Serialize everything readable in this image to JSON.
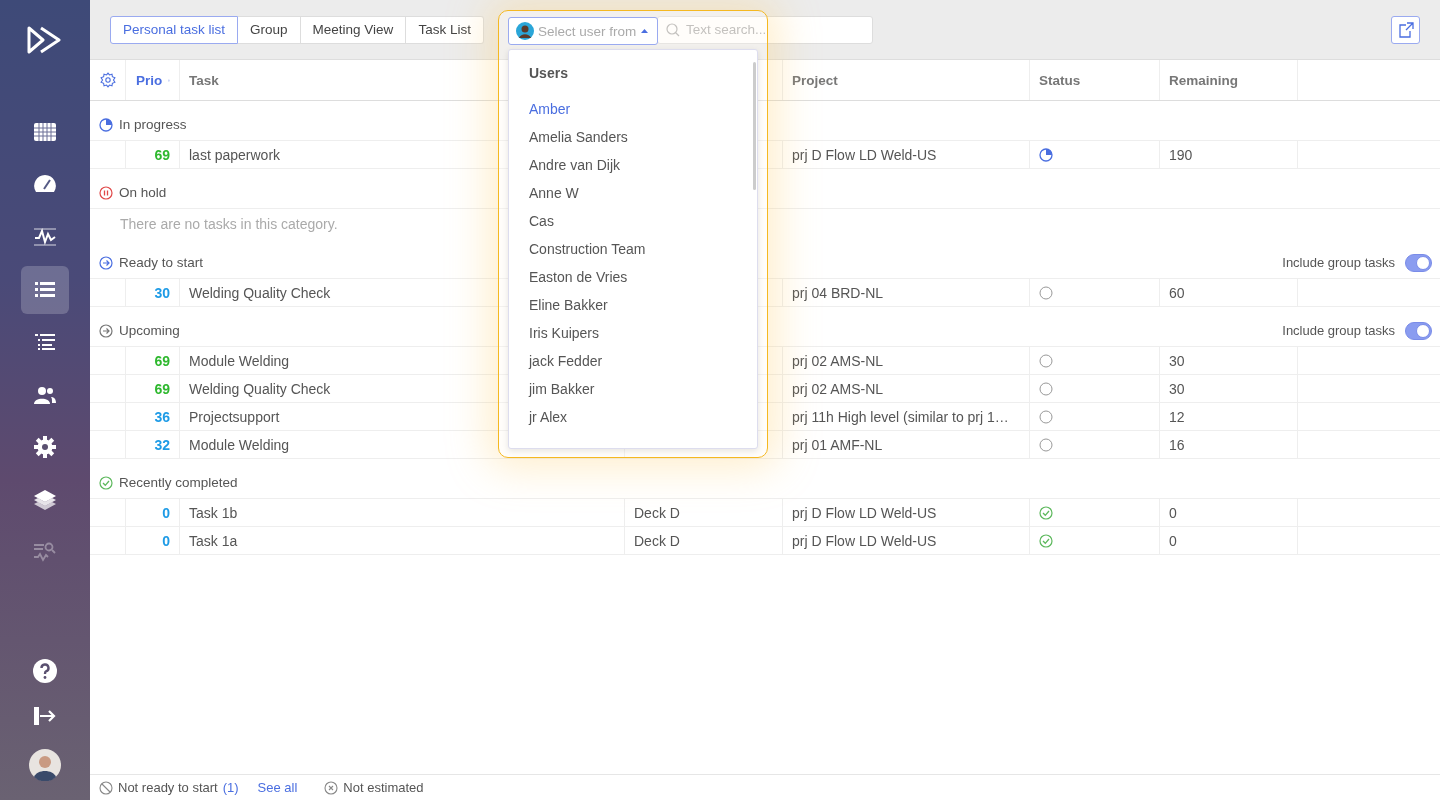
{
  "sidebar": {
    "items": [
      {
        "kind": "grid",
        "selected": false,
        "disabled": false
      },
      {
        "kind": "gauge",
        "selected": false,
        "disabled": false
      },
      {
        "kind": "pulse",
        "selected": false,
        "disabled": false
      },
      {
        "kind": "list",
        "selected": true,
        "disabled": false
      },
      {
        "kind": "tree",
        "selected": false,
        "disabled": false
      },
      {
        "kind": "users",
        "selected": false,
        "disabled": false
      },
      {
        "kind": "gear",
        "selected": false,
        "disabled": false
      },
      {
        "kind": "layers",
        "selected": false,
        "disabled": false
      },
      {
        "kind": "search-pulse",
        "selected": false,
        "disabled": true
      }
    ],
    "bottom": [
      {
        "kind": "help"
      },
      {
        "kind": "logout"
      },
      {
        "kind": "avatar"
      }
    ]
  },
  "tabs": [
    {
      "label": "Personal task list",
      "selected": true
    },
    {
      "label": "Group",
      "selected": false
    },
    {
      "label": "Meeting View",
      "selected": false
    },
    {
      "label": "Task List",
      "selected": false
    }
  ],
  "user_select": {
    "placeholder": "Select user from"
  },
  "search": {
    "placeholder": "Text search..."
  },
  "columns": {
    "prio": "Prio",
    "task": "Task",
    "project": "Project",
    "status": "Status",
    "remaining": "Remaining"
  },
  "sections": [
    {
      "kind": "in_progress",
      "title": "In progress",
      "rows": [
        {
          "kind": "in_progress",
          "prio": "69",
          "color": "#2eb82e",
          "task": "last paperwork",
          "project": "prj D Flow LD Weld-US",
          "remaining": "190"
        }
      ]
    },
    {
      "kind": "on_hold",
      "title": "On hold",
      "empty_message": "There are no tasks in this category."
    },
    {
      "kind": "ready",
      "title": "Ready to start",
      "include_group_tasks": true,
      "toggle_label": "Include group tasks",
      "rows": [
        {
          "kind": "not_started",
          "prio": "30",
          "color": "#1e9be6",
          "task": "Welding Quality Check",
          "project": "prj 04 BRD-NL",
          "remaining": "60"
        }
      ]
    },
    {
      "kind": "upcoming",
      "title": "Upcoming",
      "include_group_tasks": true,
      "toggle_label": "Include group tasks",
      "rows": [
        {
          "kind": "not_started",
          "prio": "69",
          "color": "#2eb82e",
          "task": "Module Welding",
          "project": "prj 02 AMS-NL",
          "remaining": "30"
        },
        {
          "kind": "not_started",
          "prio": "69",
          "color": "#2eb82e",
          "task": "Welding Quality Check",
          "project": "prj 02 AMS-NL",
          "remaining": "30"
        },
        {
          "kind": "not_started",
          "prio": "36",
          "color": "#1e9be6",
          "task": "Projectsupport",
          "project": "prj 11h High level (similar to prj 1…",
          "remaining": "12"
        },
        {
          "kind": "not_started",
          "prio": "32",
          "color": "#1e9be6",
          "task": "Module Welding",
          "project": "prj 01 AMF-NL",
          "remaining": "16"
        }
      ]
    },
    {
      "kind": "completed",
      "title": "Recently completed",
      "rows": [
        {
          "kind": "done",
          "prio": "0",
          "color": "#1e9be6",
          "task": "Task 1b",
          "column_3": "Deck D",
          "project": "prj D Flow LD Weld-US",
          "remaining": "0"
        },
        {
          "kind": "done",
          "prio": "0",
          "color": "#1e9be6",
          "task": "Task 1a",
          "column_3": "Deck D",
          "project": "prj D Flow LD Weld-US",
          "remaining": "0"
        }
      ]
    }
  ],
  "dropdown": {
    "heading": "Users",
    "items": [
      {
        "label": "Amber",
        "selected": true
      },
      {
        "label": "Amelia Sanders",
        "selected": false
      },
      {
        "label": "Andre van Dijk",
        "selected": false
      },
      {
        "label": "Anne W",
        "selected": false
      },
      {
        "label": "Cas",
        "selected": false
      },
      {
        "label": "Construction Team",
        "selected": false
      },
      {
        "label": "Easton de Vries",
        "selected": false
      },
      {
        "label": "Eline Bakker",
        "selected": false
      },
      {
        "label": "Iris Kuipers",
        "selected": false
      },
      {
        "label": "jack Fedder",
        "selected": false
      },
      {
        "label": "jim Bakker",
        "selected": false
      },
      {
        "label": "jr Alex",
        "selected": false
      }
    ]
  },
  "footer": {
    "not_ready": "Not ready to start",
    "not_ready_count": "(1)",
    "see_all": "See all",
    "not_estimated": "Not estimated"
  }
}
